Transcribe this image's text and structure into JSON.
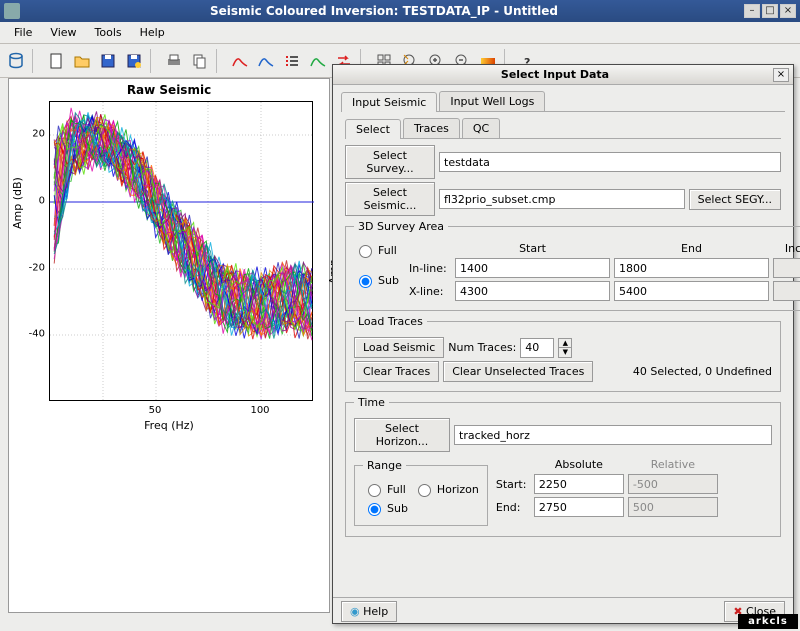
{
  "window": {
    "title": "Seismic Coloured Inversion: TESTDATA_IP - Untitled"
  },
  "menu": {
    "file": "File",
    "view": "View",
    "tools": "Tools",
    "help": "Help"
  },
  "chart": {
    "title": "Raw Seismic",
    "ylabel": "Amp (dB)",
    "ylabel2": "Amp",
    "xlabel": "Freq (Hz)",
    "xticks": [
      "50",
      "100"
    ],
    "yticks": [
      "-40",
      "-20",
      "0",
      "20"
    ]
  },
  "chart_data": {
    "type": "line",
    "title": "Raw Seismic",
    "xlabel": "Freq (Hz)",
    "ylabel": "Amp (dB)",
    "xlim": [
      0,
      125
    ],
    "ylim": [
      -55,
      35
    ],
    "note": "~40 overlaid seismic amplitude spectra traces; values peak around 20-28 dB near 5-25 Hz, crossing 0 dB near 50-55 Hz, flattening around -22 to -30 dB above 90 Hz",
    "series_count": 40,
    "envelope": {
      "x": [
        2,
        10,
        20,
        30,
        40,
        50,
        60,
        70,
        80,
        90,
        100,
        110,
        120
      ],
      "y_high": [
        22,
        30,
        29,
        27,
        21,
        11,
        2,
        -6,
        -14,
        -18,
        -18,
        -16,
        -16
      ],
      "y_low": [
        -12,
        15,
        18,
        16,
        8,
        -2,
        -12,
        -22,
        -30,
        -33,
        -33,
        -32,
        -33
      ]
    }
  },
  "dialog": {
    "title": "Select Input Data",
    "tabs1": {
      "seismic": "Input Seismic",
      "well": "Input Well Logs"
    },
    "tabs2": {
      "select": "Select",
      "traces": "Traces",
      "qc": "QC"
    },
    "survey_btn": "Select Survey...",
    "survey_val": "testdata",
    "seismic_btn": "Select Seismic...",
    "seismic_val": "fl32prio_subset.cmp",
    "segy_btn": "Select SEGY...",
    "area": {
      "legend": "3D Survey Area",
      "full": "Full",
      "sub": "Sub",
      "start_h": "Start",
      "end_h": "End",
      "inc_h": "Inc",
      "inline": "In-line:",
      "inline_start": "1400",
      "inline_end": "1800",
      "inline_inc": "",
      "xline": "X-line:",
      "xline_start": "4300",
      "xline_end": "5400",
      "xline_inc": ""
    },
    "load": {
      "legend": "Load Traces",
      "load_btn": "Load Seismic",
      "num_label": "Num Traces:",
      "num": "40",
      "clear_btn": "Clear Traces",
      "clear_unsel_btn": "Clear Unselected Traces",
      "status": "40 Selected, 0 Undefined"
    },
    "time": {
      "legend": "Time",
      "horizon_btn": "Select Horizon...",
      "horizon_val": "tracked_horz",
      "range_legend": "Range",
      "full": "Full",
      "horizon": "Horizon",
      "sub": "Sub",
      "abs_h": "Absolute",
      "rel_h": "Relative",
      "start_l": "Start:",
      "start_abs": "2250",
      "start_rel": "-500",
      "end_l": "End:",
      "end_abs": "2750",
      "end_rel": "500"
    },
    "help": "Help",
    "close": "Close"
  },
  "logo": "arkcls"
}
